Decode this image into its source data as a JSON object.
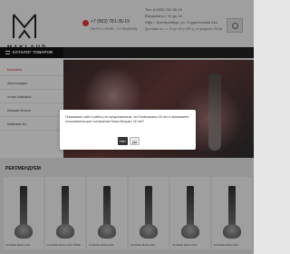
{
  "header": {
    "logo_text": "MAKLAUD",
    "phone_primary": "+7 (902) 781-36-19",
    "phone_secondary": "Пн-Пт с 09:00 - 17:00 (МСК)",
    "email": "Тел: 8 (902) 781-36-19",
    "hours": "Ежедневно с 12 до 24",
    "address": "Ифп г. Екатеринбург, ул. Студенческая 44а",
    "delivery": "Доставка по г. с 10 до 19 (с 400 р.) в пределах ЕКАД"
  },
  "nav": {
    "catalog_label": "КАТАЛОГ ТОВАРОВ"
  },
  "sidebar": {
    "items": [
      {
        "label": "Кальяны"
      },
      {
        "label": "Аксессуары"
      },
      {
        "label": "Уголь Maklaud"
      },
      {
        "label": "Кальян Kuzari"
      },
      {
        "label": "Maklaud Air"
      }
    ]
  },
  "modal": {
    "text": "Показывать сайт и работу по предложенным, что БанКальяны 18 лет и принимаете пользовательское соглашение Kaшо Возраст 18 лет?",
    "no_label": "Нет",
    "yes_label": "Да"
  },
  "recommended": {
    "title": "РЕКОМЕНДУЕМ",
    "products": [
      {
        "label": "КАЛЬЯН MAKLAUD"
      },
      {
        "label": "КАЛЬЯН MAKLAUD TRIBE"
      },
      {
        "label": "КАЛЬЯН MAKLAUD"
      },
      {
        "label": "КАЛЬЯН MAKLAUD"
      },
      {
        "label": "КАЛЬЯН MAKLAUD"
      },
      {
        "label": "КАЛЬЯН MAKLAUD"
      }
    ]
  },
  "colors": {
    "accent": "#d32f2f",
    "nav_bg": "#222222"
  }
}
